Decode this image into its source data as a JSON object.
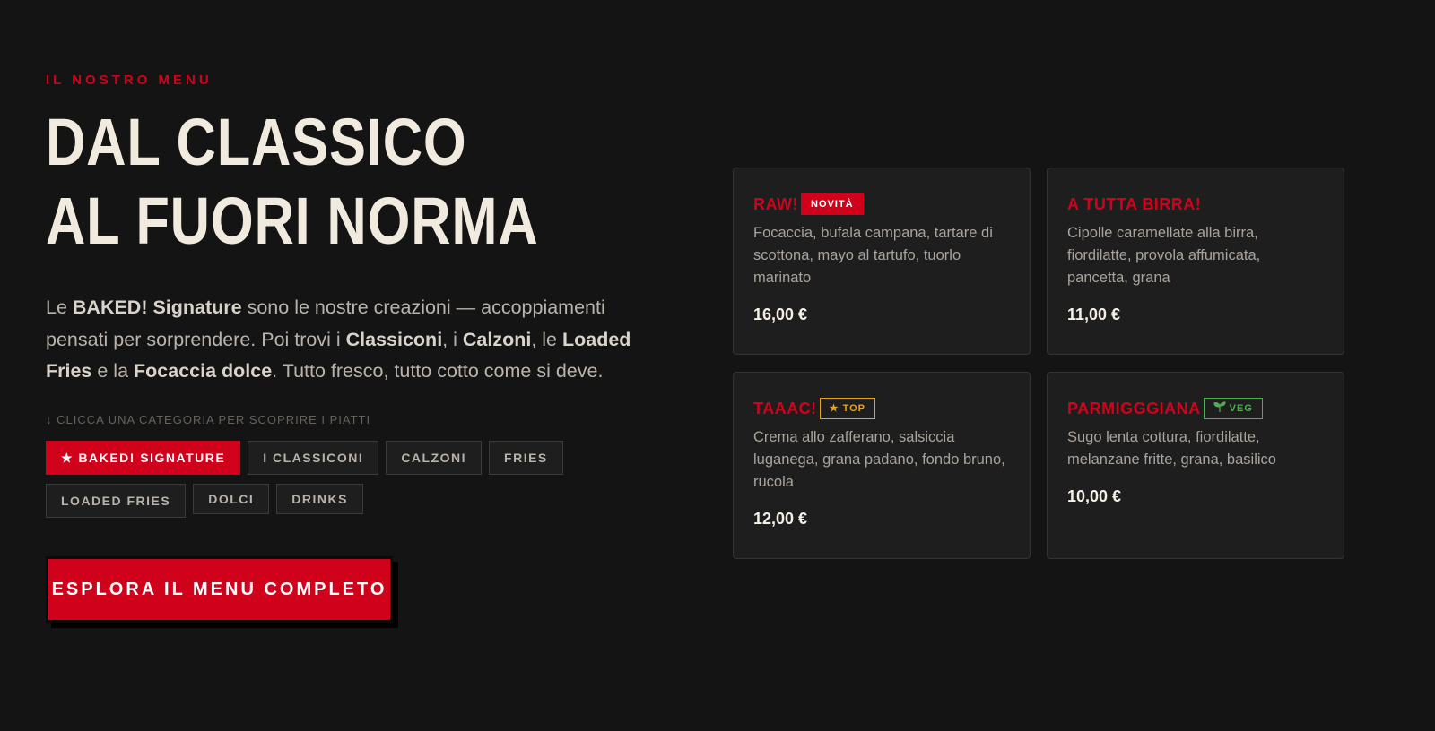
{
  "section": {
    "eyebrow": "IL NOSTRO MENU",
    "headline_line1": "DAL CLASSICO",
    "headline_line2": "AL FUORI NORMA",
    "intro": {
      "t1": "Le ",
      "b1": "BAKED! Signature",
      "t2": " sono le nostre creazioni — accoppiamenti pensati per sorprendere. Poi trovi i ",
      "b2": "Classiconi",
      "t3": ", i ",
      "b3": "Calzoni",
      "t4": ", le ",
      "b4": "Loaded Fries",
      "t5": " e la ",
      "b5": "Focaccia dolce",
      "t6": ". Tutto fresco, tutto cotto come si deve."
    },
    "hint": "↓ CLICCA UNA CATEGORIA PER SCOPRIRE I PIATTI"
  },
  "categories": [
    {
      "label": "★ BAKED! SIGNATURE",
      "active": true
    },
    {
      "label": "I CLASSICONI",
      "active": false
    },
    {
      "label": "CALZONI",
      "active": false
    },
    {
      "label": "FRIES",
      "active": false
    },
    {
      "label": "LOADED FRIES",
      "active": false
    },
    {
      "label": "DOLCI",
      "active": false
    },
    {
      "label": "DRINKS",
      "active": false
    }
  ],
  "cta": {
    "label": "ESPLORA IL MENU COMPLETO"
  },
  "dishes": [
    {
      "name": "RAW!",
      "badge": "NOVITÀ",
      "badge_type": "new",
      "description": "Focaccia, bufala campana, tartare di scottona, mayo al tartufo, tuorlo marinato",
      "price": "16,00 €"
    },
    {
      "name": "A TUTTA BIRRA!",
      "badge": "",
      "badge_type": "",
      "description": "Cipolle caramellate alla birra, fiordilatte, provola affumicata, pancetta, grana",
      "price": "11,00 €"
    },
    {
      "name": "TAAAC!",
      "badge": "★ TOP",
      "badge_type": "top",
      "description": "Crema allo zafferano, salsiccia luganega, grana padano, fondo bruno, rucola",
      "price": "12,00 €"
    },
    {
      "name": "PARMIGGGIANA",
      "badge": "VEG",
      "badge_type": "veg",
      "description": "Sugo lenta cottura, fiordilatte, melanzane fritte, grana, basilico",
      "price": "10,00 €"
    }
  ],
  "colors": {
    "accent": "#d0021b",
    "background": "#141414",
    "card": "#1e1e1e",
    "top_badge": "#e8a317",
    "veg_badge": "#4caf50"
  },
  "icons": {
    "signature_chip": "star-icon",
    "top_badge": "star-icon",
    "veg_badge": "sprout-icon",
    "hint": "arrow-down-icon"
  }
}
